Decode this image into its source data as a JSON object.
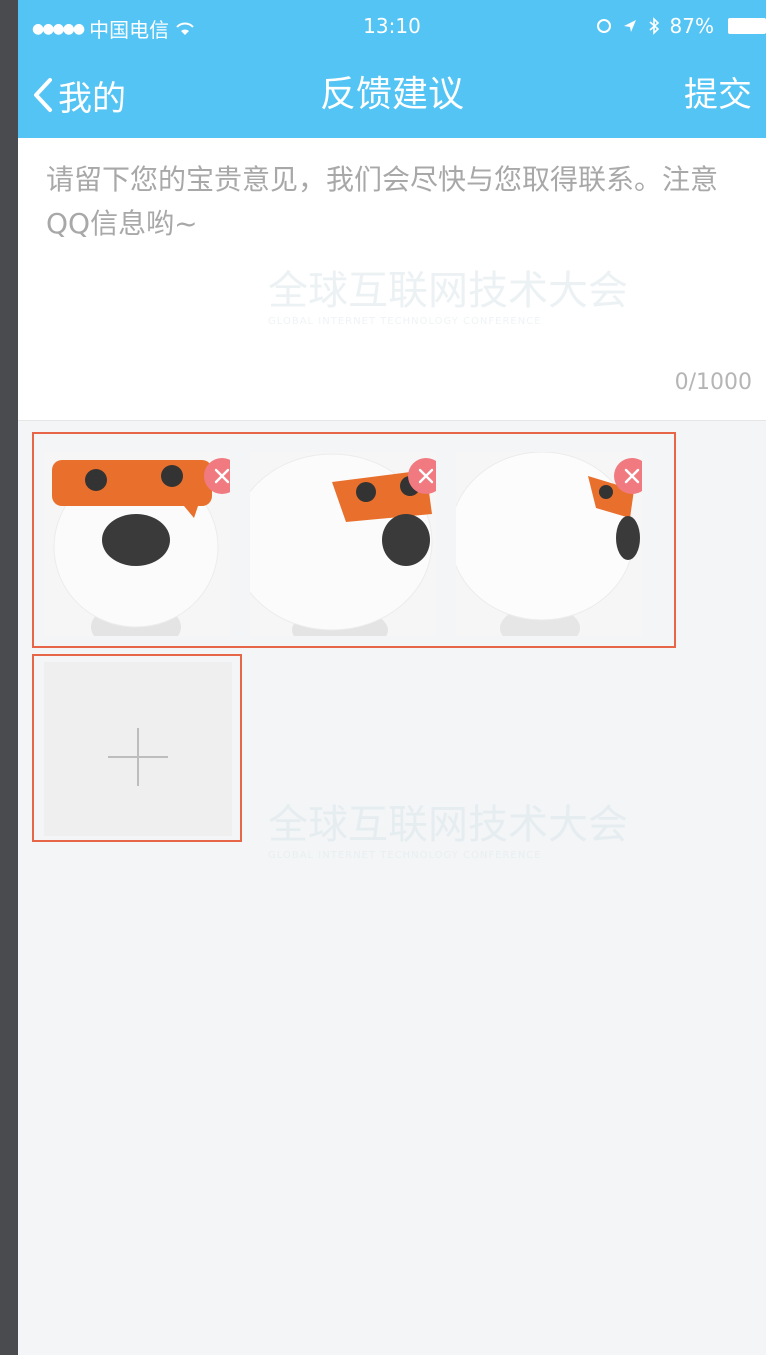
{
  "status_bar": {
    "carrier": "中国电信",
    "time": "13:10",
    "battery": "87%"
  },
  "nav": {
    "back_label": "我的",
    "title": "反馈建议",
    "submit_label": "提交"
  },
  "feedback": {
    "placeholder": "请留下您的宝贵意见，我们会尽快与您取得联系。注意QQ信息哟~",
    "counter": "0/1000"
  },
  "watermark": {
    "text": "全球互联网技术大会",
    "subtext": "GLOBAL INTERNET TECHNOLOGY CONFERENCE"
  },
  "photos": {
    "items": [
      {
        "icon": "mascot-photo-front"
      },
      {
        "icon": "mascot-photo-three-quarter"
      },
      {
        "icon": "mascot-photo-side"
      }
    ],
    "delete_icon": "close-icon",
    "add_icon": "plus-icon"
  },
  "colors": {
    "nav_bg": "#54c4f4",
    "page_bg": "#f3f5f6",
    "highlight_border": "#e86648",
    "delete_badge": "#f07a80"
  }
}
